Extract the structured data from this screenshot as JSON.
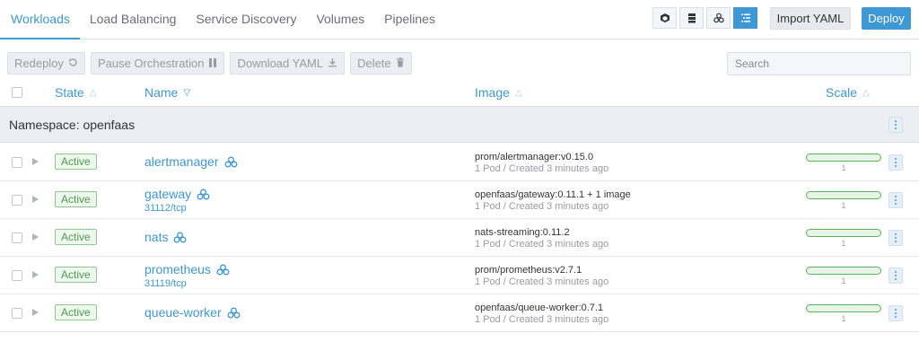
{
  "tabs": [
    {
      "label": "Workloads",
      "active": true
    },
    {
      "label": "Load Balancing",
      "active": false
    },
    {
      "label": "Service Discovery",
      "active": false
    },
    {
      "label": "Volumes",
      "active": false
    },
    {
      "label": "Pipelines",
      "active": false
    }
  ],
  "view_buttons": [
    {
      "icon": "cube-icon",
      "active": false
    },
    {
      "icon": "server-icon",
      "active": false
    },
    {
      "icon": "cluster-icon",
      "active": false
    },
    {
      "icon": "list-icon",
      "active": true
    }
  ],
  "toolbar": {
    "import_label": "Import YAML",
    "deploy_label": "Deploy"
  },
  "actions": {
    "redeploy": "Redeploy",
    "pause": "Pause Orchestration",
    "download": "Download YAML",
    "delete": "Delete"
  },
  "search": {
    "placeholder": "Search",
    "value": ""
  },
  "columns": {
    "state": "State",
    "name": "Name",
    "image": "Image",
    "scale": "Scale"
  },
  "namespace": {
    "label": "Namespace: openfaas"
  },
  "rows": [
    {
      "state": "Active",
      "name": "alertmanager",
      "port": "",
      "image": "prom/alertmanager:v0.15.0",
      "meta": "1 Pod / Created 3 minutes ago",
      "scale": "1"
    },
    {
      "state": "Active",
      "name": "gateway",
      "port": "31112/tcp",
      "image": "openfaas/gateway:0.11.1 + 1 image",
      "meta": "1 Pod / Created 3 minutes ago",
      "scale": "1"
    },
    {
      "state": "Active",
      "name": "nats",
      "port": "",
      "image": "nats-streaming:0.11.2",
      "meta": "1 Pod / Created 3 minutes ago",
      "scale": "1"
    },
    {
      "state": "Active",
      "name": "prometheus",
      "port": "31119/tcp",
      "image": "prom/prometheus:v2.7.1",
      "meta": "1 Pod / Created 3 minutes ago",
      "scale": "1"
    },
    {
      "state": "Active",
      "name": "queue-worker",
      "port": "",
      "image": "openfaas/queue-worker:0.7.1",
      "meta": "1 Pod / Created 3 minutes ago",
      "scale": "1"
    }
  ],
  "colors": {
    "accent": "#3d98d3",
    "active_green": "#4c9b4e"
  }
}
